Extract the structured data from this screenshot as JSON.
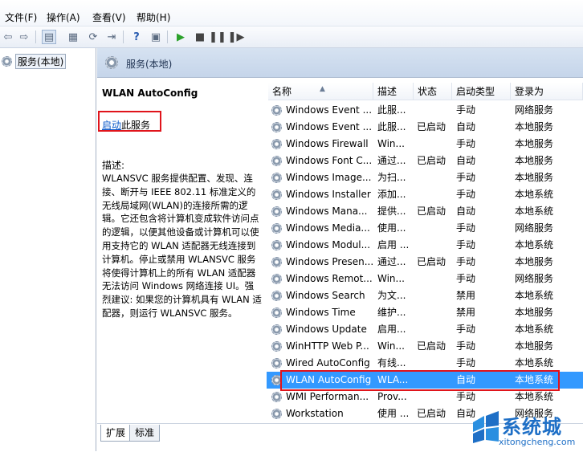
{
  "menu": [
    "文件(F)",
    "操作(A)",
    "查看(V)",
    "帮助(H)"
  ],
  "tree": {
    "root_label": "服务(本地)"
  },
  "header": {
    "title": "服务(本地)"
  },
  "detail": {
    "service_name": "WLAN AutoConfig",
    "start_link": "启动",
    "start_suffix": "此服务",
    "desc_label": "描述:",
    "description": "WLANSVC 服务提供配置、发现、连接、断开与 IEEE 802.11 标准定义的无线局域网(WLAN)的连接所需的逻辑。它还包含将计算机变成软件访问点的逻辑，以便其他设备或计算机可以使用支持它的 WLAN 适配器无线连接到计算机。停止或禁用 WLANSVC 服务将使得计算机上的所有 WLAN 适配器无法访问 Windows 网络连接 UI。强烈建议: 如果您的计算机具有 WLAN 适配器，则运行 WLANSVC 服务。"
  },
  "columns": {
    "name": "名称",
    "desc": "描述",
    "status": "状态",
    "startup": "启动类型",
    "logon": "登录为"
  },
  "services": [
    {
      "name": "Windows Event ...",
      "desc": "此服...",
      "status": "",
      "startup": "手动",
      "logon": "网络服务"
    },
    {
      "name": "Windows Event ...",
      "desc": "此服...",
      "status": "已启动",
      "startup": "自动",
      "logon": "本地服务"
    },
    {
      "name": "Windows Firewall",
      "desc": "Win...",
      "status": "",
      "startup": "手动",
      "logon": "本地服务"
    },
    {
      "name": "Windows Font C...",
      "desc": "通过...",
      "status": "已启动",
      "startup": "自动",
      "logon": "本地服务"
    },
    {
      "name": "Windows Image...",
      "desc": "为扫...",
      "status": "",
      "startup": "手动",
      "logon": "本地服务"
    },
    {
      "name": "Windows Installer",
      "desc": "添加...",
      "status": "",
      "startup": "手动",
      "logon": "本地系统"
    },
    {
      "name": "Windows Mana...",
      "desc": "提供...",
      "status": "已启动",
      "startup": "自动",
      "logon": "本地系统"
    },
    {
      "name": "Windows Media...",
      "desc": "使用...",
      "status": "",
      "startup": "手动",
      "logon": "网络服务"
    },
    {
      "name": "Windows Modul...",
      "desc": "启用 ...",
      "status": "",
      "startup": "手动",
      "logon": "本地系统"
    },
    {
      "name": "Windows Presen...",
      "desc": "通过...",
      "status": "已启动",
      "startup": "手动",
      "logon": "本地服务"
    },
    {
      "name": "Windows Remot...",
      "desc": "Win...",
      "status": "",
      "startup": "手动",
      "logon": "网络服务"
    },
    {
      "name": "Windows Search",
      "desc": "为文...",
      "status": "",
      "startup": "禁用",
      "logon": "本地系统"
    },
    {
      "name": "Windows Time",
      "desc": "维护...",
      "status": "",
      "startup": "禁用",
      "logon": "本地服务"
    },
    {
      "name": "Windows Update",
      "desc": "启用...",
      "status": "",
      "startup": "手动",
      "logon": "本地系统"
    },
    {
      "name": "WinHTTP Web P...",
      "desc": "Win...",
      "status": "已启动",
      "startup": "手动",
      "logon": "本地服务"
    },
    {
      "name": "Wired AutoConfig",
      "desc": "有线...",
      "status": "",
      "startup": "手动",
      "logon": "本地系统"
    },
    {
      "name": "WLAN AutoConfig",
      "desc": "WLA...",
      "status": "",
      "startup": "自动",
      "logon": "本地系统",
      "selected": true
    },
    {
      "name": "WMI Performan...",
      "desc": "Prov...",
      "status": "",
      "startup": "手动",
      "logon": "本地系统"
    },
    {
      "name": "Workstation",
      "desc": "使用 ...",
      "status": "已启动",
      "startup": "自动",
      "logon": "网络服务"
    }
  ],
  "tabs": [
    "扩展",
    "标准"
  ],
  "watermark": {
    "brand": "系统城",
    "url": "xitongcheng.com"
  },
  "colors": {
    "selection": "#3399ff",
    "highlight_box": "#e0141b",
    "link": "#0a59c9"
  }
}
